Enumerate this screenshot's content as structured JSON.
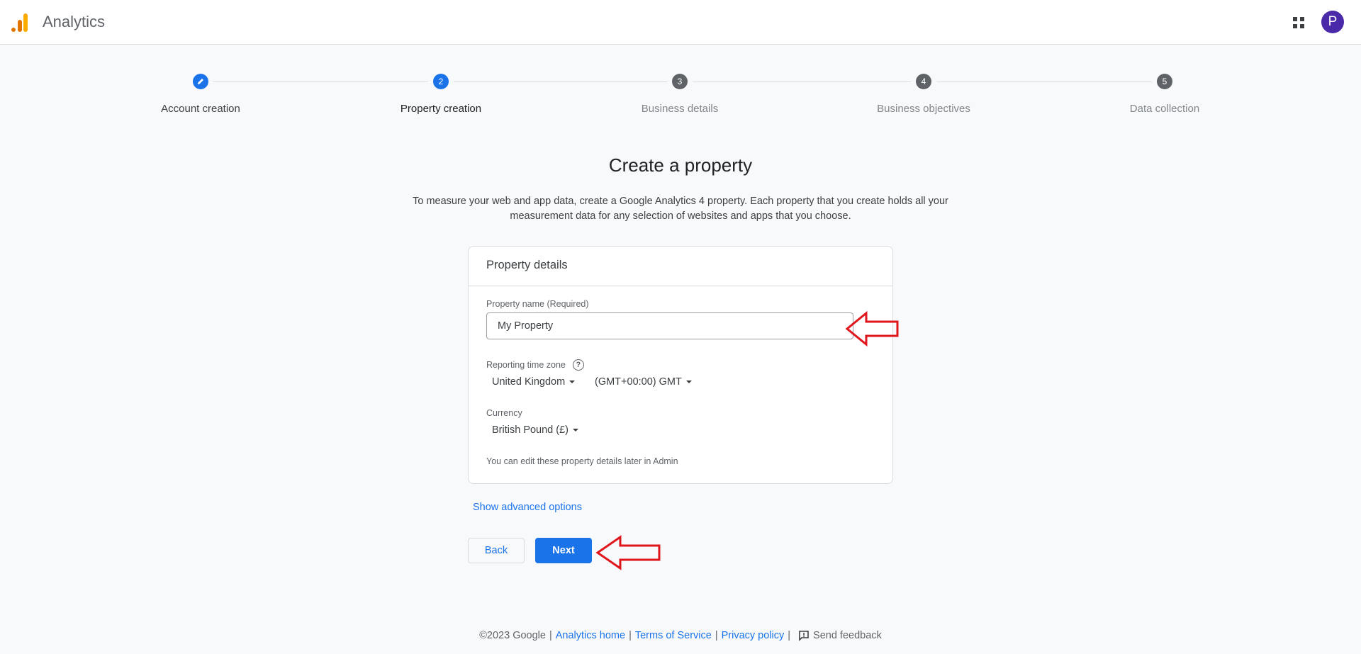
{
  "header": {
    "app_title": "Analytics",
    "avatar_letter": "P",
    "logo_colors": [
      "#e37400",
      "#f9ab00"
    ]
  },
  "stepper": {
    "steps": [
      {
        "number": "",
        "label": "Account creation",
        "state": "completed",
        "icon": "pencil-icon"
      },
      {
        "number": "2",
        "label": "Property creation",
        "state": "active"
      },
      {
        "number": "3",
        "label": "Business details",
        "state": "pending"
      },
      {
        "number": "4",
        "label": "Business objectives",
        "state": "pending"
      },
      {
        "number": "5",
        "label": "Data collection",
        "state": "pending"
      }
    ]
  },
  "main": {
    "title": "Create a property",
    "description": "To measure your web and app data, create a Google Analytics 4 property. Each property that you create holds all your measurement data for any selection of websites and apps that you choose.",
    "card": {
      "title": "Property details",
      "property_name_label": "Property name (Required)",
      "property_name_value": "My Property",
      "timezone_label": "Reporting time zone",
      "country": "United Kingdom",
      "timezone": "(GMT+00:00) GMT",
      "currency_label": "Currency",
      "currency": "British Pound (£)",
      "note": "You can edit these property details later in Admin"
    },
    "advanced_link": "Show advanced options",
    "back_label": "Back",
    "next_label": "Next"
  },
  "footer": {
    "copyright": "©2023 Google",
    "sep": "|",
    "links": [
      "Analytics home",
      "Terms of Service",
      "Privacy policy"
    ],
    "feedback": "Send feedback"
  },
  "colors": {
    "accent": "#1a73e8",
    "annotation_arrow": "#e0161d"
  }
}
